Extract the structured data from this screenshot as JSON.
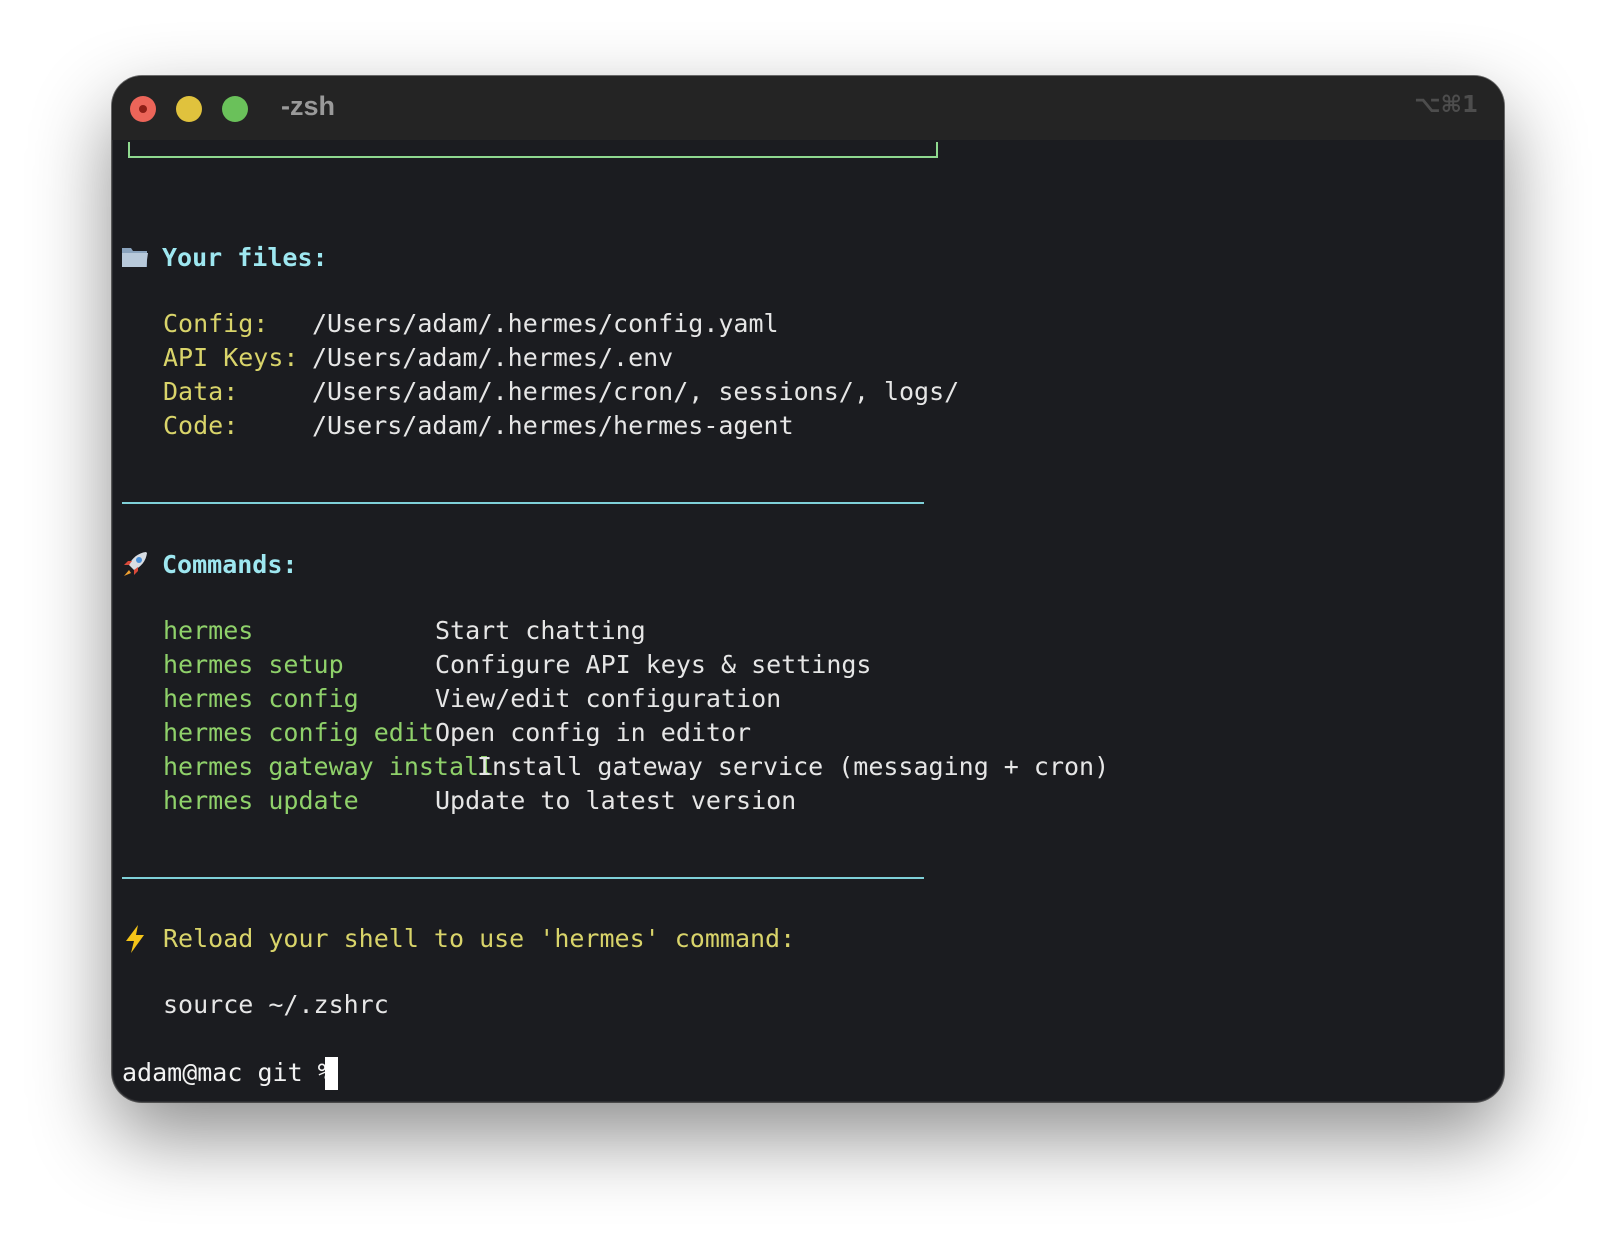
{
  "window": {
    "title": "-zsh",
    "shortcut": "⌥⌘1"
  },
  "files": {
    "heading": "Your files:",
    "icon": "folder-icon",
    "items": [
      {
        "label": "Config:",
        "value": "/Users/adam/.hermes/config.yaml"
      },
      {
        "label": "API Keys:",
        "value": "/Users/adam/.hermes/.env"
      },
      {
        "label": "Data:",
        "value": "/Users/adam/.hermes/cron/, sessions/, logs/"
      },
      {
        "label": "Code:",
        "value": "/Users/adam/.hermes/hermes-agent"
      }
    ]
  },
  "commands": {
    "heading": "Commands:",
    "icon": "rocket-icon",
    "items": [
      {
        "cmd": "hermes",
        "desc": "Start chatting"
      },
      {
        "cmd": "hermes setup",
        "desc": "Configure API keys & settings"
      },
      {
        "cmd": "hermes config",
        "desc": "View/edit configuration"
      },
      {
        "cmd": "hermes config edit",
        "desc": "Open config in editor"
      },
      {
        "cmd": "hermes gateway install",
        "desc": "Install gateway service (messaging + cron)"
      },
      {
        "cmd": "hermes update",
        "desc": "Update to latest version"
      }
    ]
  },
  "reload": {
    "icon": "lightning-icon",
    "message": "Reload your shell to use 'hermes' command:",
    "command": "source ~/.zshrc"
  },
  "prompt": {
    "text": "adam@mac git % "
  },
  "colors": {
    "background": "#1b1c20",
    "heading": "#9ee7f0",
    "label": "#d9d46a",
    "command": "#8fd16a",
    "rule": "#7fd0d8",
    "box": "#8fd88f"
  }
}
